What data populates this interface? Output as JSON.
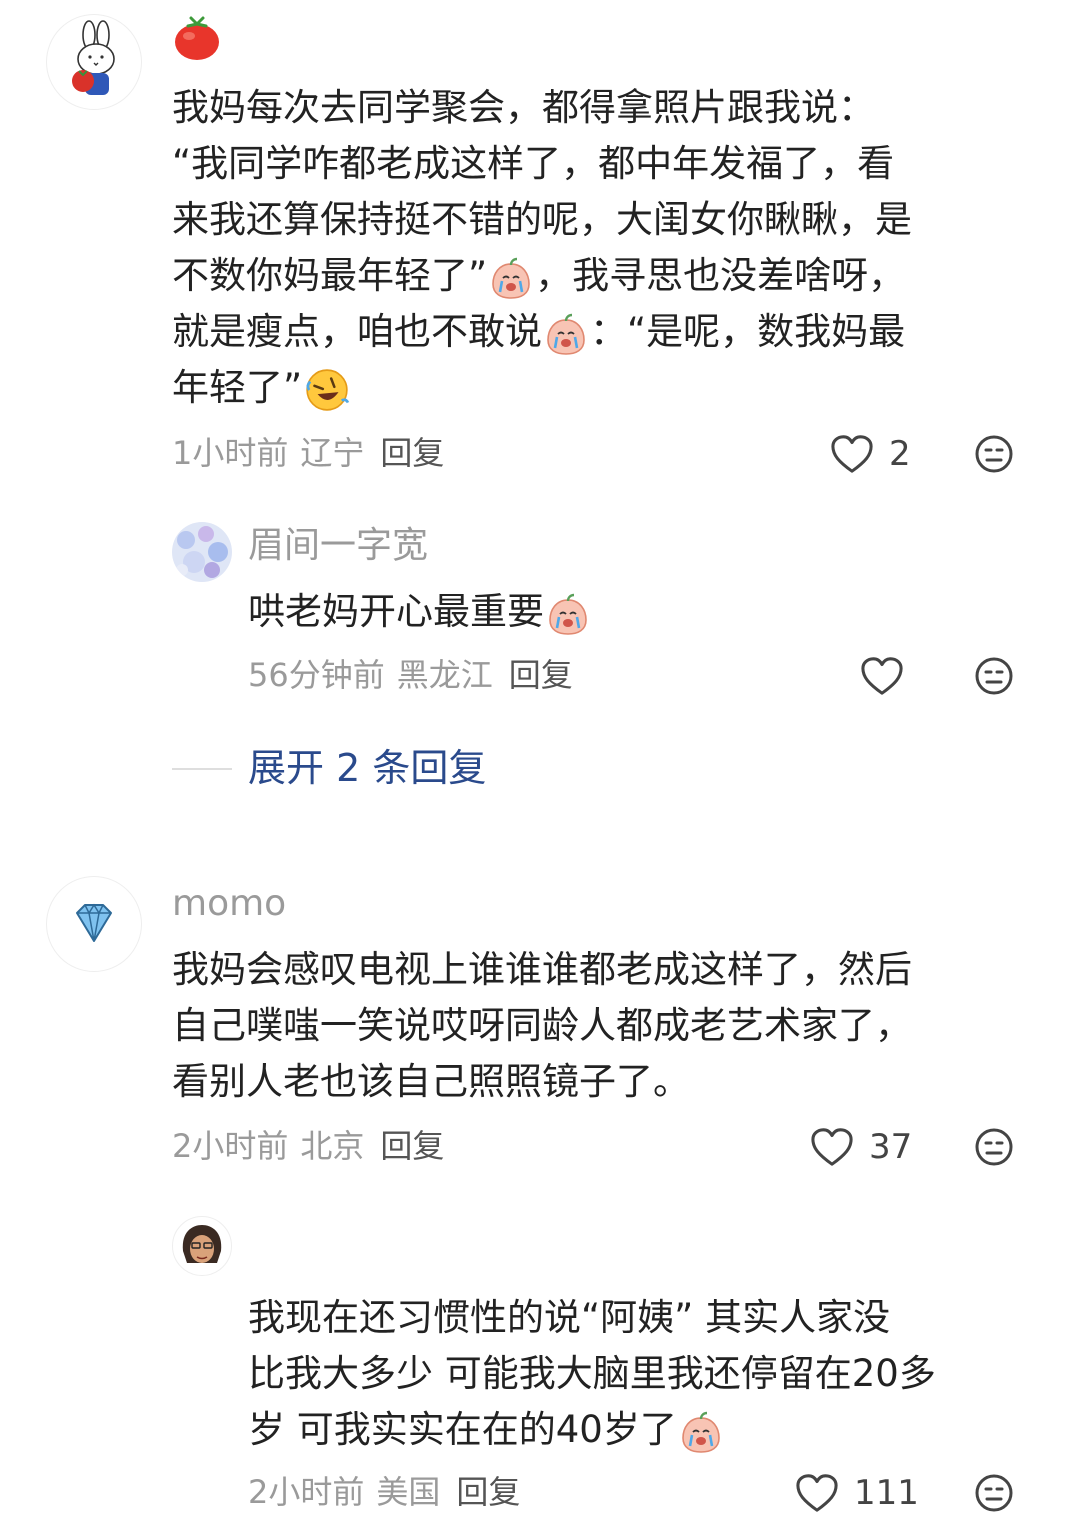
{
  "comments": [
    {
      "username": "",
      "avatar_icon": "bunny-tomato-avatar",
      "name_icon": "tomato-emoji",
      "lines": [
        "我妈每次去同学聚会，都得拿照片跟我说：",
        "“我同学咋都老成这样了，都中年发福了，看",
        "来我还算保持挺不错的呢，大闺女你瞅瞅，是",
        "不数你妈最年轻了”",
        "，我寻思也没差啥呀，",
        "就是瘦点，咱也不敢说",
        "：“是呢，数我妈最",
        "年轻了”"
      ],
      "time": "1小时前",
      "location": "辽宁",
      "reply_label": "回复",
      "likes": "2",
      "replies": [
        {
          "username": "眉间一字宽",
          "avatar_icon": "blue-flowers-avatar",
          "text": "哄老妈开心最重要",
          "time": "56分钟前",
          "location": "黑龙江",
          "reply_label": "回复",
          "likes": ""
        }
      ],
      "expand_label": "展开 2 条回复"
    },
    {
      "username": "momo",
      "avatar_icon": "diamond-avatar",
      "lines": [
        "我妈会感叹电视上谁谁谁都老成这样了，然后",
        "自己噗嗤一笑说哎呀同龄人都成老艺术家了，",
        "看别人老也该自己照照镜子了。"
      ],
      "time": "2小时前",
      "location": "北京",
      "reply_label": "回复",
      "likes": "37",
      "replies": [
        {
          "username": "",
          "avatar_icon": "cartoon-face-avatar",
          "lines": [
            "我现在还习惯性的说“阿姨” 其实人家没",
            "比我大多少 可能我大脑里我还停留在20多",
            "岁 可我实实在在的40岁了"
          ],
          "time": "2小时前",
          "location": "美国",
          "reply_label": "回复",
          "likes": "111"
        }
      ]
    }
  ],
  "colors": {
    "meta_text": "#9a9a9a",
    "expand_link": "#2a4a8c",
    "body_text": "#222222"
  }
}
